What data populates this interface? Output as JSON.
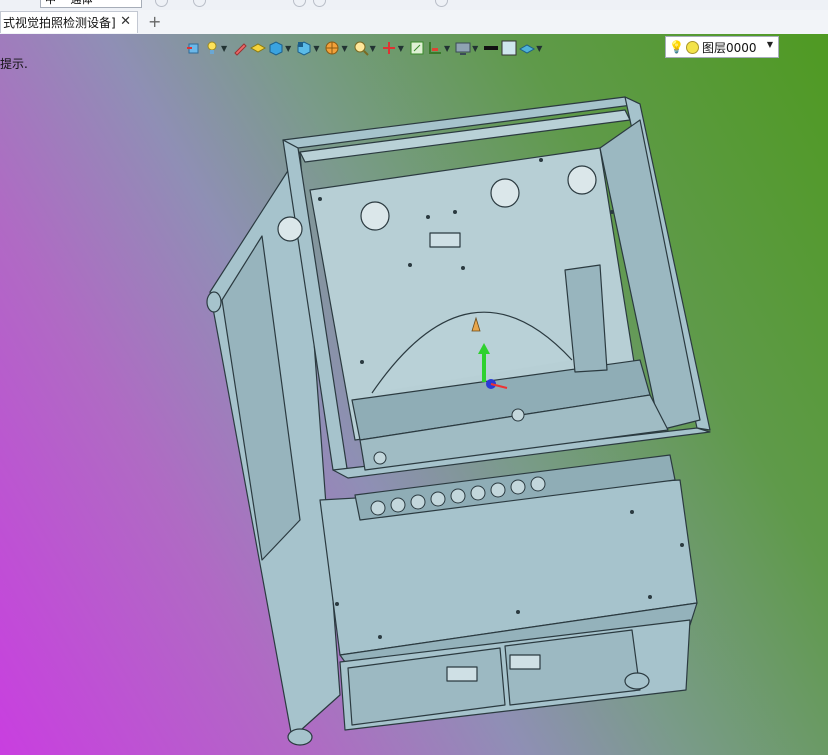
{
  "top_strip": {
    "combo_value": "中 一通体"
  },
  "tab": {
    "title": "式视觉拍照检测设备]",
    "close": "✕",
    "new": "+"
  },
  "viewport": {
    "hint": "提示."
  },
  "toolbar": {
    "icons": [
      "view-orient-icon",
      "light-icon",
      "pencil-icon",
      "box-icon",
      "cube-shade-icon",
      "cube-view-icon",
      "section-icon",
      "zoom-icon",
      "axis-icon",
      "frame-icon",
      "clip-icon",
      "display-icon",
      "line-color-icon",
      "fill-color-icon",
      "layer-plane-icon"
    ]
  },
  "layer": {
    "name": "图层0000"
  },
  "colors": {
    "model_fill": "#a6c3cc",
    "model_stroke": "#2b3a40",
    "accent_green": "#2ed12e"
  }
}
